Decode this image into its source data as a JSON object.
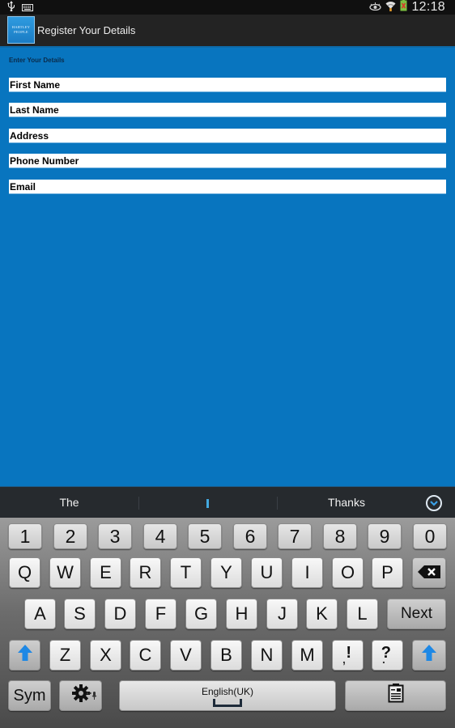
{
  "status_bar": {
    "left_icons": [
      "usb-icon",
      "keyboard-icon"
    ],
    "right_icons": [
      "eye-icon",
      "wifi-icon",
      "battery-icon"
    ],
    "time": "12:18"
  },
  "action_bar": {
    "logo_text": [
      "HARTLEY",
      "PEOPLE"
    ],
    "title": "Register Your Details"
  },
  "form": {
    "heading": "Enter Your Details",
    "fields": [
      {
        "name": "first-name",
        "value": "First Name"
      },
      {
        "name": "last-name",
        "value": "Last Name"
      },
      {
        "name": "address",
        "value": "Address"
      },
      {
        "name": "phone-number",
        "value": "Phone Number"
      },
      {
        "name": "email",
        "value": "Email"
      }
    ],
    "colors": {
      "background": "#0875bf",
      "field": "#ffffff"
    }
  },
  "suggestions": {
    "items": [
      "The",
      "I",
      "Thanks"
    ],
    "collapse_icon": "chevron-down-circle-icon"
  },
  "keyboard": {
    "number_row": [
      "1",
      "2",
      "3",
      "4",
      "5",
      "6",
      "7",
      "8",
      "9",
      "0"
    ],
    "row1": [
      "Q",
      "W",
      "E",
      "R",
      "T",
      "Y",
      "U",
      "I",
      "O",
      "P"
    ],
    "row2": [
      "A",
      "S",
      "D",
      "F",
      "G",
      "H",
      "J",
      "K",
      "L"
    ],
    "row3": [
      "Z",
      "X",
      "C",
      "V",
      "B",
      "N",
      "M"
    ],
    "next_label": "Next",
    "comma_key": {
      "primary": ",",
      "secondary": "!"
    },
    "period_key": {
      "primary": ".",
      "secondary": "?"
    },
    "sym_label": "Sym",
    "space_label": "English(UK)",
    "icons": {
      "backspace": "backspace-icon",
      "shift": "shift-arrow-icon",
      "settings": "gear-icon",
      "clipboard": "clipboard-icon"
    },
    "accent_color": "#1e88e5"
  }
}
